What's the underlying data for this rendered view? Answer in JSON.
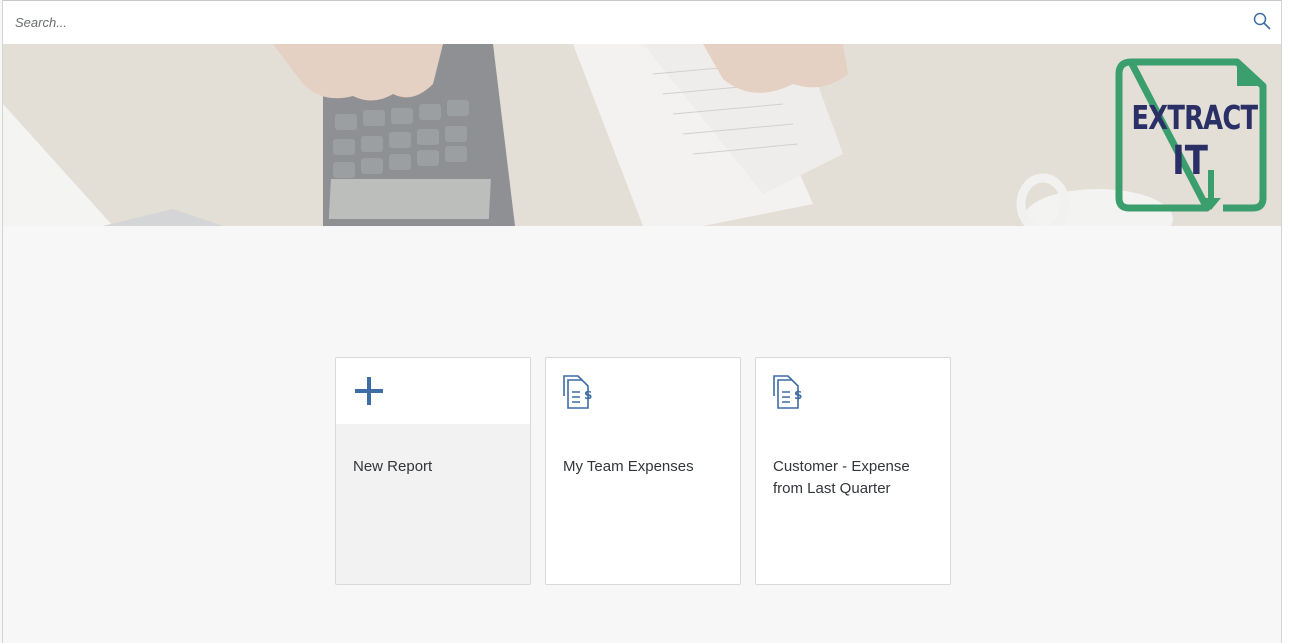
{
  "search": {
    "placeholder": "Search..."
  },
  "banner": {
    "logo_line1": "EXTRACT",
    "logo_line2": "IT",
    "logo_colors": {
      "frame": "#3a9f6d",
      "text": "#2a2f66",
      "arrow": "#3a9f6d"
    }
  },
  "tiles": [
    {
      "label": "New Report",
      "icon": "plus-icon"
    },
    {
      "label": "My Team Expenses",
      "icon": "expense-document-icon"
    },
    {
      "label": "Customer - Expense from Last Quarter",
      "icon": "expense-document-icon"
    }
  ],
  "colors": {
    "accent": "#3e6ca5",
    "background": "#f7f7f7",
    "tile_bg": "#ffffff",
    "tile_border": "#d9d9d9"
  }
}
